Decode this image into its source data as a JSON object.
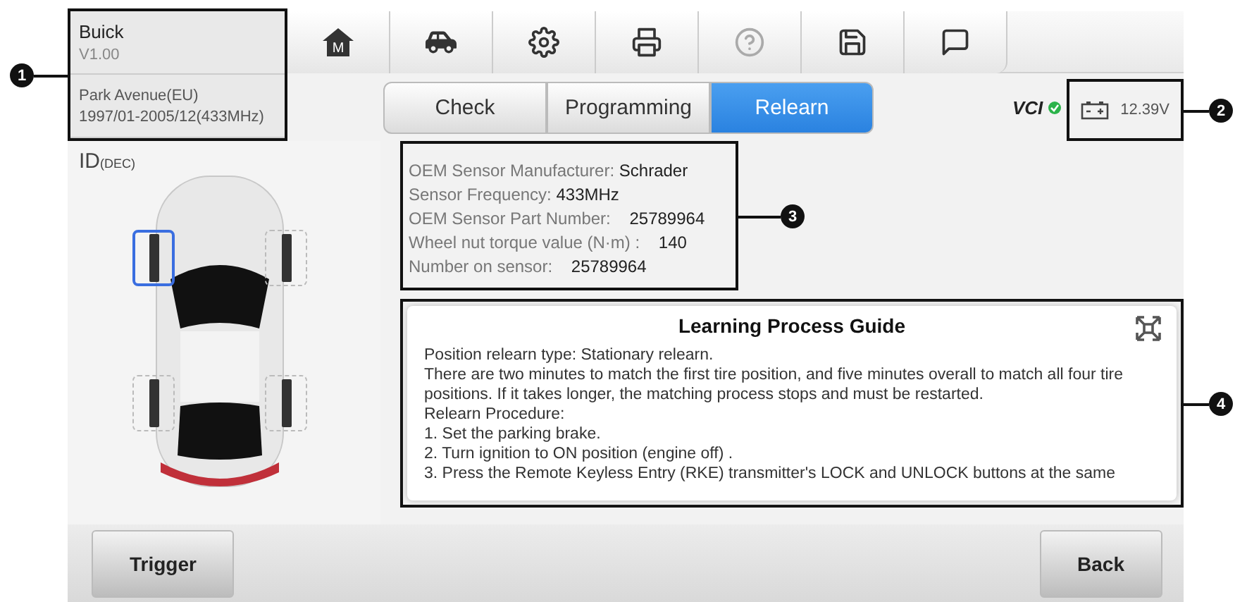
{
  "vehicle": {
    "make": "Buick",
    "version": "V1.00",
    "model": "Park Avenue(EU)",
    "range": "1997/01-2005/12(433MHz)"
  },
  "toolbar": [
    {
      "kind": "home",
      "label": "M",
      "disabled": false
    },
    {
      "kind": "lift",
      "disabled": false
    },
    {
      "kind": "settings",
      "disabled": false
    },
    {
      "kind": "print",
      "disabled": false
    },
    {
      "kind": "help",
      "disabled": true
    },
    {
      "kind": "save",
      "disabled": false
    },
    {
      "kind": "message",
      "disabled": false
    }
  ],
  "tabs": [
    {
      "label": "Check",
      "selected": false
    },
    {
      "label": "Programming",
      "selected": false
    },
    {
      "label": "Relearn",
      "selected": true
    }
  ],
  "vci": {
    "label": "VCI",
    "connected": true
  },
  "battery": {
    "voltage": "12.39V"
  },
  "id_label": {
    "main": "ID",
    "sub": "(DEC)"
  },
  "tires": [
    {
      "selected": true
    },
    {
      "selected": false
    },
    {
      "selected": false
    },
    {
      "selected": false
    }
  ],
  "sensor_info": [
    {
      "label": "OEM Sensor Manufacturer:",
      "value": "Schrader"
    },
    {
      "label": "Sensor Frequency:",
      "value": "433MHz"
    },
    {
      "label": "OEM Sensor Part Number:",
      "value": "25789964"
    },
    {
      "label": "Wheel nut torque value (N·m) :",
      "value": "140"
    },
    {
      "label": "Number on sensor:",
      "value": "25789964"
    }
  ],
  "guide": {
    "title": "Learning Process Guide",
    "lines": [
      "Position relearn type: Stationary relearn.",
      "There are two minutes to match the first tire position, and five minutes overall to match all four tire positions. If it takes longer, the matching process stops and must be restarted.",
      "Relearn Procedure:",
      "1. Set the parking brake.",
      "2. Turn ignition to ON position (engine off) .",
      "3. Press the Remote Keyless Entry (RKE) transmitter's LOCK and UNLOCK buttons at the same"
    ]
  },
  "buttons": [
    {
      "label": "Trigger"
    },
    {
      "label": "Back"
    }
  ],
  "callouts": [
    {
      "number": "1"
    },
    {
      "number": "2"
    },
    {
      "number": "3"
    },
    {
      "number": "4"
    }
  ]
}
